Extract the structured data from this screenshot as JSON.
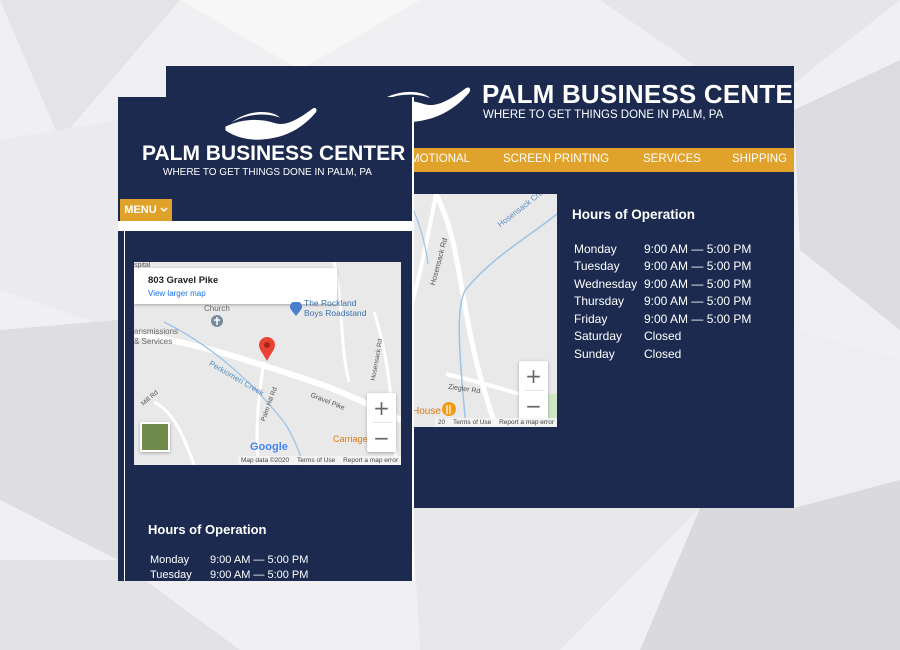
{
  "brand": {
    "name": "PALM BUSINESS CENTER",
    "tagline": "WHERE TO GET THINGS DONE IN PALM, PA"
  },
  "desktop": {
    "nav": [
      "MOTIONAL",
      "SCREEN PRINTING",
      "SERVICES",
      "SHIPPING"
    ],
    "hours_title": "Hours of Operation",
    "hours": [
      {
        "day": "Monday",
        "time": "9:00 AM — 5:00 PM"
      },
      {
        "day": "Tuesday",
        "time": "9:00 AM — 5:00 PM"
      },
      {
        "day": "Wednesday",
        "time": "9:00 AM — 5:00 PM"
      },
      {
        "day": "Thursday",
        "time": "9:00 AM — 5:00 PM"
      },
      {
        "day": "Friday",
        "time": "9:00 AM — 5:00 PM"
      },
      {
        "day": "Saturday",
        "time": "Closed"
      },
      {
        "day": "Sunday",
        "time": "Closed"
      }
    ],
    "map": {
      "labels": [
        "Hosensack Creek",
        "Hosensack Rd",
        "Ziegler Rd",
        "House"
      ],
      "attribution": [
        "20",
        "Terms of Use",
        "Report a map error"
      ]
    }
  },
  "mobile": {
    "menu_label": "MENU",
    "hours_title": "Hours of Operation",
    "hours": [
      {
        "day": "Monday",
        "time": "9:00 AM — 5:00 PM"
      },
      {
        "day": "Tuesday",
        "time": "9:00 AM — 5:00 PM"
      }
    ],
    "map": {
      "info_title": "803 Gravel Pike",
      "info_link": "View larger map",
      "pin_label": "803 Gravel Pike",
      "labels": {
        "church": "Church",
        "rockland_1": "The Rockland",
        "rockland_2": "Boys Roadstand",
        "transmissions_1": "ansmissions",
        "transmissions_2": "& Services",
        "perkiomen": "Perkiomen Creek",
        "gravel_pike": "Gravel Pike",
        "hosensack": "Hosensack Rd",
        "carriage": "Carriage",
        "spital": "spital",
        "mill_rd": "Mill Rd",
        "palm_hill": "Palm Hill Rd",
        "google": "Google"
      },
      "attribution": [
        "Map data ©2020",
        "Terms of Use",
        "Report a map error"
      ]
    }
  },
  "colors": {
    "navy": "#1b2a4e",
    "gold": "#e0a22a",
    "pin_red": "#ea4335"
  }
}
